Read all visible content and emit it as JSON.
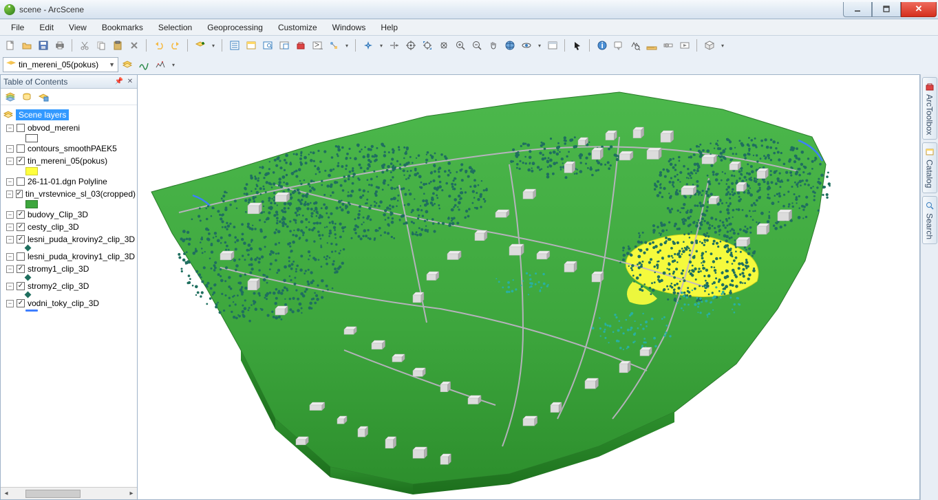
{
  "window": {
    "title": "scene - ArcScene"
  },
  "menus": [
    "File",
    "Edit",
    "View",
    "Bookmarks",
    "Selection",
    "Geoprocessing",
    "Customize",
    "Windows",
    "Help"
  ],
  "layer_combo": "tin_mereni_05(pokus)",
  "toc": {
    "title": "Table of Contents",
    "root": "Scene layers",
    "layers": [
      {
        "name": "obvod_mereni",
        "checked": false,
        "symbol": {
          "type": "swatch",
          "fill": "#ffffff",
          "border": "#555"
        }
      },
      {
        "name": "contours_smoothPAEK5",
        "checked": false,
        "symbol": null
      },
      {
        "name": "tin_mereni_05(pokus)",
        "checked": true,
        "symbol": {
          "type": "swatch",
          "fill": "#ffff3d",
          "border": "#cccc33"
        }
      },
      {
        "name": "26-11-01.dgn Polyline",
        "checked": false,
        "symbol": null
      },
      {
        "name": "tin_vrstevnice_sl_03(cropped)",
        "checked": true,
        "symbol": {
          "type": "swatch",
          "fill": "#3da63d",
          "border": "#2d7d2d"
        }
      },
      {
        "name": "budovy_Clip_3D",
        "checked": true,
        "symbol": null
      },
      {
        "name": "cesty_clip_3D",
        "checked": true,
        "symbol": null
      },
      {
        "name": "lesni_puda_kroviny2_clip_3D",
        "checked": true,
        "symbol": {
          "type": "dot",
          "fill": "#1f6f5f"
        }
      },
      {
        "name": "lesni_puda_kroviny1_clip_3D",
        "checked": false,
        "symbol": null
      },
      {
        "name": "stromy1_clip_3D",
        "checked": true,
        "symbol": {
          "type": "dot",
          "fill": "#1f6f5f"
        }
      },
      {
        "name": "stromy2_clip_3D",
        "checked": true,
        "symbol": {
          "type": "dot",
          "fill": "#1f6f5f"
        }
      },
      {
        "name": "vodni_toky_clip_3D",
        "checked": true,
        "symbol": {
          "type": "line",
          "fill": "#3d7eff"
        }
      }
    ]
  },
  "right_tabs": [
    "ArcToolbox",
    "Catalog",
    "Search"
  ],
  "colors": {
    "terrain": "#3da63d",
    "yellow": "#ffff3d",
    "trees": "#1f6f5f",
    "trees2": "#29b0a0",
    "roads": "#c2b4c9",
    "buildings_light": "#dcdcdc",
    "buildings_dark": "#b0b0b0",
    "water": "#3d7eff"
  }
}
